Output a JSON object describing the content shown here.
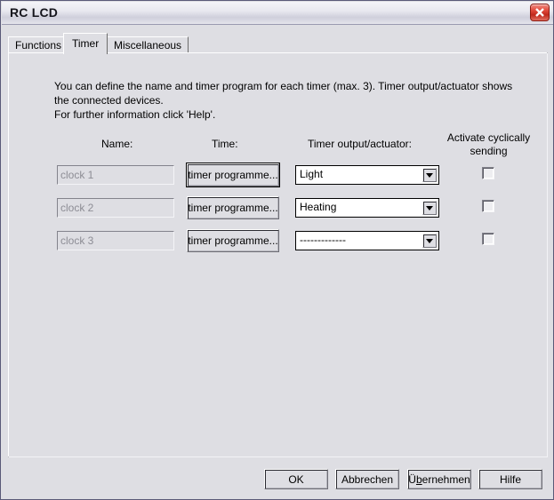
{
  "window": {
    "title": "RC LCD",
    "close_icon": "close-icon"
  },
  "tabs": [
    {
      "label": "Functions",
      "active": false
    },
    {
      "label": "Timer",
      "active": true
    },
    {
      "label": "Miscellaneous",
      "active": false
    }
  ],
  "panel": {
    "info_line_1": "You can define the name and timer program for each timer (max. 3). Timer output/actuator shows",
    "info_line_2": "the connected devices.",
    "info_line_3": "For further information click 'Help'.",
    "headers": {
      "name": "Name:",
      "time": "Time:",
      "output": "Timer output/actuator:",
      "cyclic_line1": "Activate cyclically",
      "cyclic_line2": "sending"
    },
    "rows": [
      {
        "name_value": "clock 1",
        "name_disabled": true,
        "time_button": "timer programme...",
        "time_button_focused": true,
        "output_value": "Light",
        "cyclic_checked": false
      },
      {
        "name_value": "clock 2",
        "name_disabled": true,
        "time_button": "timer programme...",
        "time_button_focused": false,
        "output_value": "Heating",
        "cyclic_checked": false
      },
      {
        "name_value": "clock 3",
        "name_disabled": true,
        "time_button": "timer programme...",
        "time_button_focused": false,
        "output_value": "-------------",
        "cyclic_checked": false
      }
    ]
  },
  "buttons": {
    "ok": "OK",
    "cancel": "Abbrechen",
    "apply_pre": "Ü",
    "apply_accel": "b",
    "apply_post": "ernehmen",
    "help": "Hilfe"
  },
  "colors": {
    "window_bg": "#dedee3",
    "titlebar_text": "#15151c",
    "close_red": "#c0291c",
    "disabled_text": "#8d8d95",
    "border_dark": "#5a5a78"
  }
}
